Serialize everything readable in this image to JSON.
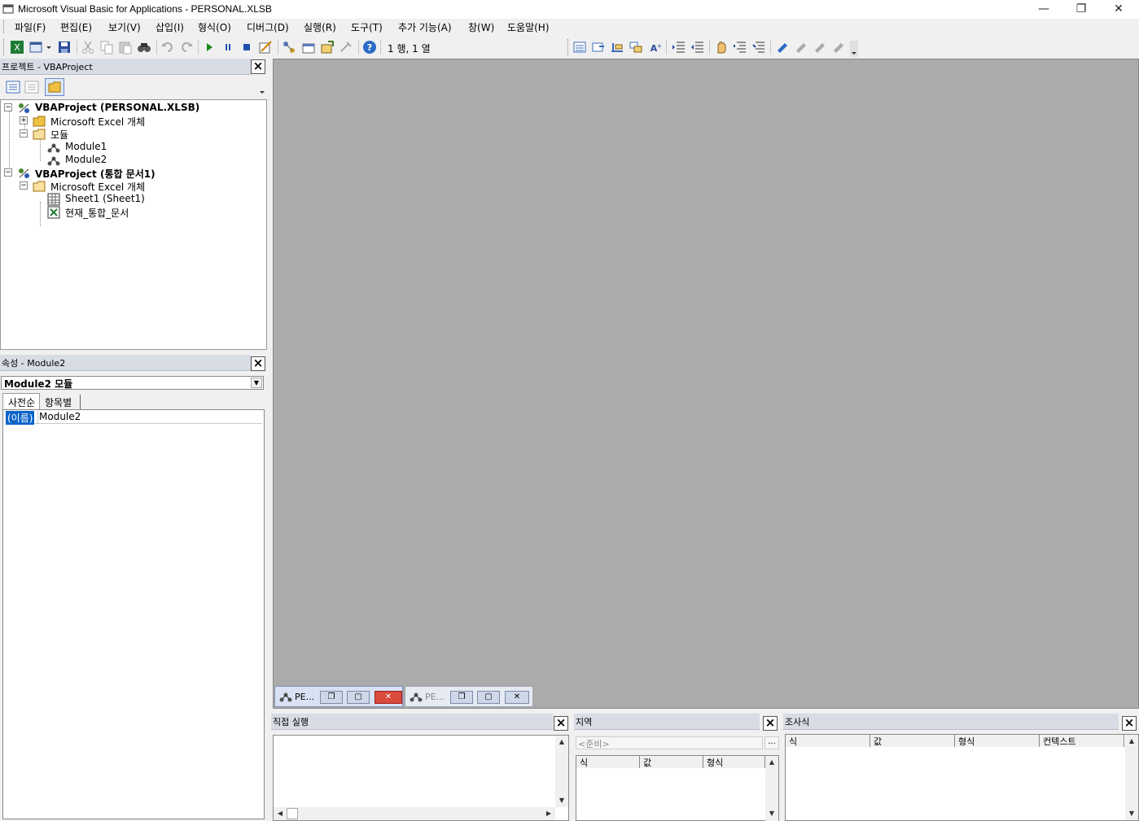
{
  "window": {
    "title": "Microsoft Visual Basic for Applications - PERSONAL.XLSB",
    "minimize": "—",
    "restore": "❐",
    "close": "✕"
  },
  "menu": [
    "파일(F)",
    "편집(E)",
    "보기(V)",
    "삽입(I)",
    "형식(O)",
    "디버그(D)",
    "실행(R)",
    "도구(T)",
    "추가 기능(A)",
    "창(W)",
    "도움말(H)"
  ],
  "toolbar": {
    "position": "1 행, 1 열"
  },
  "project": {
    "title": "프로젝트 - VBAProject",
    "tree": {
      "p1": "VBAProject (PERSONAL.XLSB)",
      "p1_objects": "Microsoft Excel 개체",
      "p1_modules": "모듈",
      "module1": "Module1",
      "module2": "Module2",
      "p2": "VBAProject (통합 문서1)",
      "p2_objects": "Microsoft Excel 개체",
      "sheet1": "Sheet1 (Sheet1)",
      "workbook": "현재_통합_문서"
    }
  },
  "properties": {
    "title": "속성 - Module2",
    "object_select": "Module2 모듈",
    "tab_alpha": "사전순",
    "tab_category": "항목별",
    "row_name": "(이름)",
    "row_value": "Module2"
  },
  "mdi_tabs": [
    {
      "label": "PE..."
    },
    {
      "label": "PE..."
    }
  ],
  "immediate": {
    "title": "직접 실행"
  },
  "locals": {
    "title": "지역",
    "context": "<준비>",
    "cols": [
      "식",
      "값",
      "형식"
    ]
  },
  "watches": {
    "title": "조사식",
    "cols": [
      "식",
      "값",
      "형식",
      "컨텍스트"
    ]
  }
}
